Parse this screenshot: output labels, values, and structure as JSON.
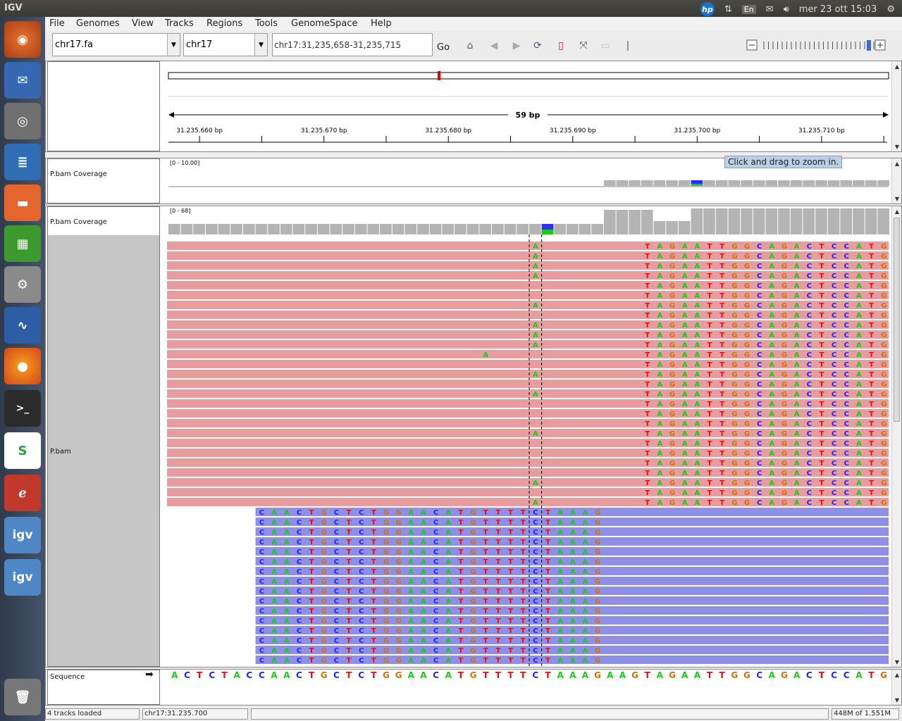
{
  "os": {
    "app_title": "IGV",
    "lang": "En",
    "clock": "mer 23 ott 15:03"
  },
  "launcher": {
    "items": [
      "ubuntu-dash-icon",
      "email-icon",
      "camera-icon",
      "writer-icon",
      "files-icon",
      "calc-icon",
      "settings-icon",
      "monitor-icon",
      "firefox-icon",
      "terminal-icon",
      "scribus-icon",
      "pdf-icon",
      "igv-icon",
      "igv-icon",
      "trash-icon"
    ],
    "igv_label": "igv"
  },
  "menu": [
    "File",
    "Genomes",
    "View",
    "Tracks",
    "Regions",
    "Tools",
    "GenomeSpace",
    "Help"
  ],
  "toolbar": {
    "genome": "chr17.fa",
    "chromosome": "chr17",
    "locus": "chr17:31,235,658-31,235,715",
    "go_label": "Go"
  },
  "ruler": {
    "span_label": "59 bp",
    "ticks": [
      "31.235.660 bp",
      "31.235.670 bp",
      "31.235.680 bp",
      "31.235.690 bp",
      "31.235.700 bp",
      "31.235.710 bp"
    ]
  },
  "tracks": {
    "coverage1": {
      "name": "P.bam Coverage",
      "range": "[0 - 10,00]"
    },
    "coverage2": {
      "name": "P.bam Coverage",
      "range": "[0 - 68]"
    },
    "bam": {
      "name": "P.bam"
    },
    "sequence": {
      "name": "Sequence",
      "strand_arrow": "➡"
    }
  },
  "tooltip": "Click and drag to zoom in.",
  "reads": {
    "pink_seq": "TAGAATTGGCAGACTCCATG",
    "blue_seq": "CAACTGCTCTGGAACATGTTTTCTAAAG",
    "snp_base": "A",
    "stray_base": "A",
    "pink_rows": 27,
    "blue_rows": 16,
    "snp_rows": [
      0,
      1,
      2,
      3,
      6,
      8,
      9,
      10,
      13,
      15,
      19,
      24,
      26
    ]
  },
  "reference_sequence": "ACTCTACCAACTGCTCTGGAACATGTTTTCTAAAGAAGTAGAATTGGCAGACTCCATG",
  "status": {
    "tracks_loaded": "4 tracks loaded",
    "position": "chr17:31.235.700",
    "memory": "448M of 1.551M"
  },
  "colors": {
    "A": "#1bc91b",
    "C": "#2222ff",
    "G": "#d17105",
    "T": "#e01010",
    "pink_read": "#e79d9d",
    "blue_read": "#8f8fe6",
    "coverage_bar": "#b4b4b4"
  }
}
